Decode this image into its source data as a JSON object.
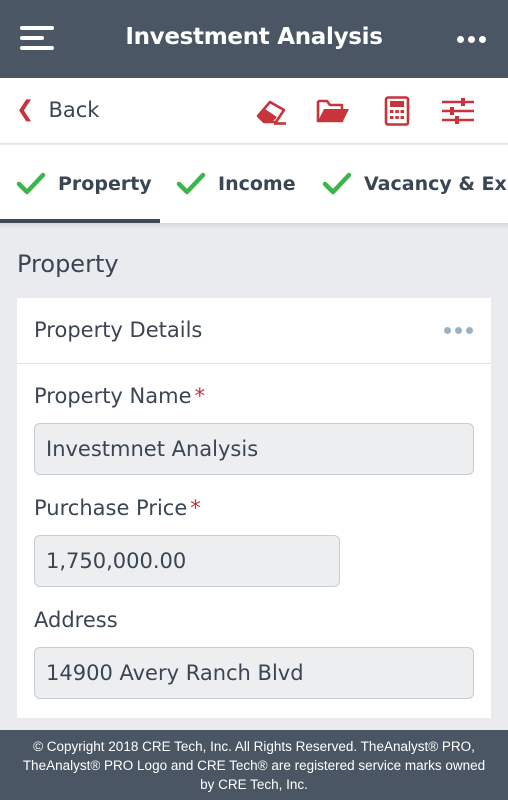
{
  "header": {
    "title": "Investment Analysis"
  },
  "toolbar": {
    "back_label": "Back",
    "icons": [
      "eraser-icon",
      "folder-open-icon",
      "calculator-icon",
      "sliders-icon"
    ],
    "accent_color": "#c8343c"
  },
  "tabs": [
    {
      "label": "Property",
      "status": "complete",
      "active": true
    },
    {
      "label": "Income",
      "status": "complete",
      "active": false
    },
    {
      "label": "Vacancy & Expe",
      "status": "complete",
      "active": false
    }
  ],
  "section": {
    "heading": "Property"
  },
  "card": {
    "title": "Property Details",
    "fields": [
      {
        "label": "Property Name",
        "required_mark": "*",
        "value": "Investmnet Analysis"
      },
      {
        "label": "Purchase Price",
        "required_mark": "*",
        "value": "1,750,000.00"
      },
      {
        "label": "Address",
        "required_mark": "",
        "value": "14900 Avery Ranch Blvd"
      }
    ]
  },
  "footer": {
    "lines": [
      "© Copyright 2018 CRE Tech, Inc. All Rights Reserved. TheAnalyst® PRO,",
      "TheAnalyst® PRO Logo and CRE Tech® are registered service marks owned",
      "by CRE Tech, Inc."
    ]
  },
  "colors": {
    "header_bg": "#4a5663",
    "check_green": "#3cb54a",
    "required_red": "#c8343c"
  }
}
